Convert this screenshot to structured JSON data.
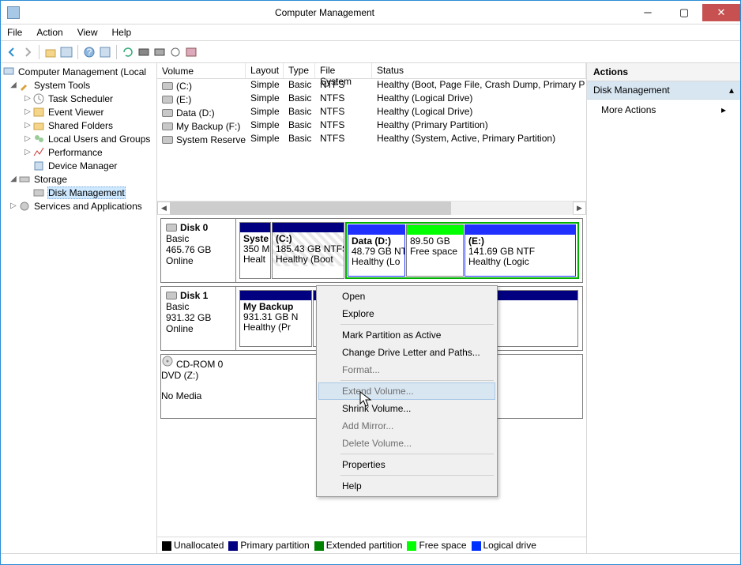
{
  "window": {
    "title": "Computer Management"
  },
  "menu": {
    "file": "File",
    "action": "Action",
    "view": "View",
    "help": "Help"
  },
  "tree": {
    "root": "Computer Management (Local",
    "systools": "System Tools",
    "task": "Task Scheduler",
    "event": "Event Viewer",
    "shared": "Shared Folders",
    "users": "Local Users and Groups",
    "perf": "Performance",
    "devmgr": "Device Manager",
    "storage": "Storage",
    "diskmgmt": "Disk Management",
    "services": "Services and Applications"
  },
  "cols": {
    "volume": "Volume",
    "layout": "Layout",
    "type": "Type",
    "fs": "File System",
    "status": "Status"
  },
  "volumes": [
    {
      "name": "(C:)",
      "layout": "Simple",
      "type": "Basic",
      "fs": "NTFS",
      "status": "Healthy (Boot, Page File, Crash Dump, Primary P"
    },
    {
      "name": "(E:)",
      "layout": "Simple",
      "type": "Basic",
      "fs": "NTFS",
      "status": "Healthy (Logical Drive)"
    },
    {
      "name": "Data (D:)",
      "layout": "Simple",
      "type": "Basic",
      "fs": "NTFS",
      "status": "Healthy (Logical Drive)"
    },
    {
      "name": "My Backup (F:)",
      "layout": "Simple",
      "type": "Basic",
      "fs": "NTFS",
      "status": "Healthy (Primary Partition)"
    },
    {
      "name": "System Reserved",
      "layout": "Simple",
      "type": "Basic",
      "fs": "NTFS",
      "status": "Healthy (System, Active, Primary Partition)"
    }
  ],
  "disk0": {
    "title": "Disk 0",
    "bus": "Basic",
    "size": "465.76 GB",
    "state": "Online",
    "p0": {
      "name": "Syste",
      "l2": "350 M",
      "l3": "Healt"
    },
    "p1": {
      "name": "(C:)",
      "l2": "185.43 GB NTFS",
      "l3": "Healthy (Boot"
    },
    "p2": {
      "name": "Data  (D:)",
      "l2": "48.79 GB NT",
      "l3": "Healthy (Lo"
    },
    "p3": {
      "name": "",
      "l2": "89.50 GB",
      "l3": "Free space"
    },
    "p4": {
      "name": "(E:)",
      "l2": "141.69 GB NTF",
      "l3": "Healthy (Logic"
    }
  },
  "disk1": {
    "title": "Disk 1",
    "bus": "Basic",
    "size": "931.32 GB",
    "state": "Online",
    "p0": {
      "name": "My Backup",
      "l2": "931.31 GB N",
      "l3": "Healthy (Pr"
    }
  },
  "cdrom": {
    "title": "CD-ROM 0",
    "bus": "DVD (Z:)",
    "state": "No Media"
  },
  "legend": {
    "unalloc": "Unallocated",
    "primary": "Primary partition",
    "ext": "Extended partition",
    "free": "Free space",
    "logical": "Logical drive"
  },
  "actions": {
    "header": "Actions",
    "dm": "Disk Management",
    "more": "More Actions"
  },
  "ctx": {
    "open": "Open",
    "explore": "Explore",
    "mark": "Mark Partition as Active",
    "change": "Change Drive Letter and Paths...",
    "format": "Format...",
    "extend": "Extend Volume...",
    "shrink": "Shrink Volume...",
    "mirror": "Add Mirror...",
    "delete": "Delete Volume...",
    "props": "Properties",
    "help": "Help"
  }
}
